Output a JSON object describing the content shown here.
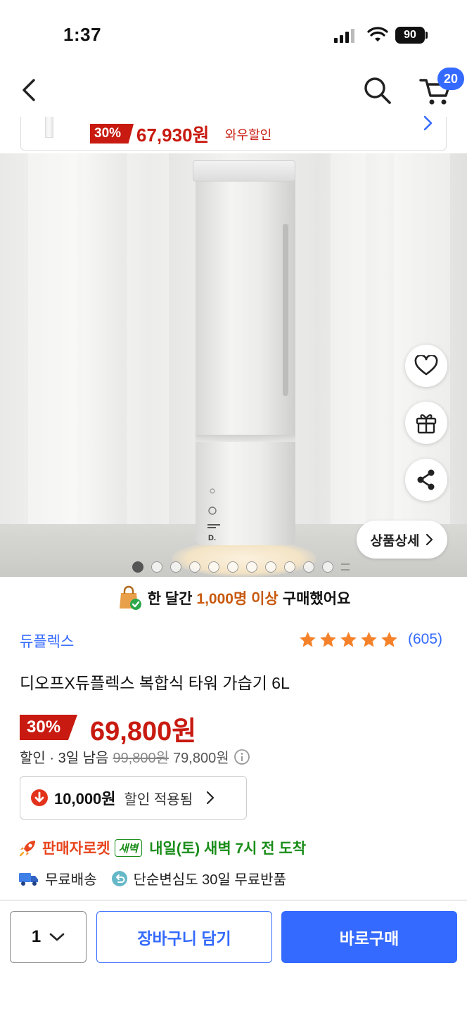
{
  "status_bar": {
    "time": "1:37",
    "battery": "90"
  },
  "header": {
    "cart_count": "20"
  },
  "sticky_bar": {
    "discount": "30%",
    "price": "67,930원",
    "suffix": "와우할인"
  },
  "gallery": {
    "detail_button": "상품상세",
    "total_images": 11,
    "active_index": 0
  },
  "purchase_notice": {
    "prefix": "한 달간",
    "count": "1,000명 이상",
    "suffix": "구매했어요"
  },
  "product": {
    "brand": "듀플렉스",
    "rating": 5,
    "review_count": "(605)",
    "title": "디오프X듀플렉스 복합식 타워 가습기 6L",
    "discount_rate": "30%",
    "price": "69,800원",
    "sale_info": "할인 · 3일 남음",
    "original_price": "99,800원",
    "reference_price": "79,800원"
  },
  "coupon": {
    "amount": "10,000원",
    "label": "할인 적용됨"
  },
  "delivery": {
    "rocket": "판매자로켓",
    "dawn_tag": "새벽",
    "eta": "내일(토) 새벽 7시 전 도착",
    "free_shipping": "무료배송",
    "returns": "단순변심도 30일 무료반품"
  },
  "bottom_bar": {
    "quantity": "1",
    "add_to_cart": "장바구니 담기",
    "buy_now": "바로구매"
  },
  "colors": {
    "accent": "#346aff",
    "sale": "#c81a10",
    "rocket_green": "#1a8d1a"
  }
}
